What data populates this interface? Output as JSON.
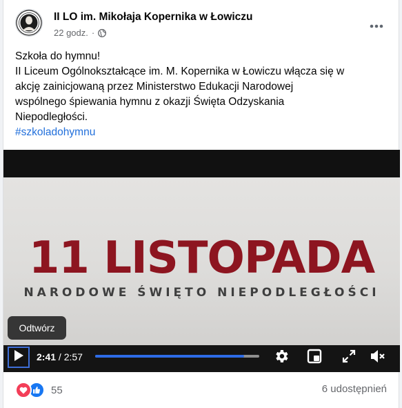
{
  "post": {
    "page_name": "II LO im. Mikołaja Kopernika w Łowiczu",
    "timestamp": "22 godz.",
    "separator": "·",
    "privacy_icon": "globe-icon",
    "more_icon": "more-options-icon",
    "text_lines": [
      "Szkoła do hymnu!",
      "II Liceum Ogólnokształcące im. M. Kopernika w Łowiczu włącza się w",
      "akcję zainicjowaną przez Ministerstwo Edukacji Narodowej",
      "wspólnego śpiewania hymnu z okazji Święta Odzyskania",
      "Niepodległości."
    ],
    "hashtag": "#szkoladohymnu"
  },
  "video": {
    "headline": "11 LISTOPADA",
    "subline": "NARODOWE ŚWIĘTO NIEPODLEGŁOŚCI",
    "tooltip": "Odtwórz",
    "current_time": "2:41",
    "time_separator": " / ",
    "duration": "2:57",
    "progress_fraction": 0.907,
    "icons": [
      "play-icon",
      "settings-icon",
      "picture-in-picture-icon",
      "fullscreen-icon",
      "volume-muted-icon"
    ]
  },
  "footer": {
    "reaction_icons": [
      "heart-reaction-icon",
      "like-reaction-icon"
    ],
    "reaction_count": "55",
    "shares": "6 udostępnień"
  },
  "colors": {
    "headline_red": "#8d1520",
    "hashtag_blue": "#216fdb",
    "progress_blue": "#2d6be6",
    "heart": "#f33e58",
    "like": "#1877f2"
  }
}
